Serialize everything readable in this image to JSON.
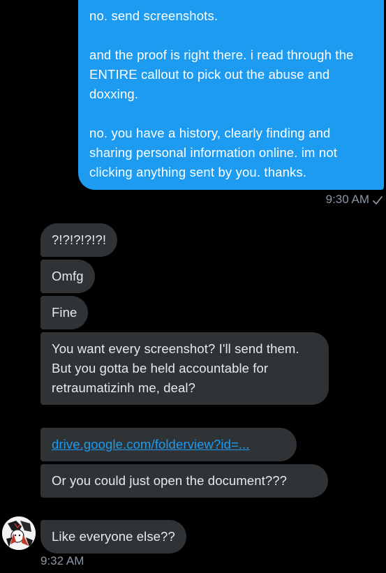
{
  "sent_message": {
    "paragraphs": [
      "no. send screenshots.",
      "and the proof is right there. i read through the ENTIRE callout to pick out the abuse and doxxing.",
      "no. you have a history, clearly finding and sharing personal information online. im not clicking anything sent by you. thanks."
    ],
    "timestamp": "9:30 AM",
    "status_icon": "check-icon"
  },
  "received_messages": [
    {
      "text": "?!?!?!?!?!"
    },
    {
      "text": "Omfg"
    },
    {
      "text": "Fine"
    },
    {
      "text": "You want every screenshot? I'll send them. But you gotta be held accountable for retraumatizinh me, deal?"
    },
    {
      "text": "drive.google.com/folderview?id=..."
    },
    {
      "text": "Or you could just open the document???"
    },
    {
      "text": "Like everyone else??"
    }
  ],
  "received_timestamp": "9:32 AM",
  "avatar_icon": "avatar-icon",
  "colors": {
    "background": "#000000",
    "sent_bubble": "#1D9BF0",
    "received_bubble": "#2F3336",
    "received_text": "#E7E9EA",
    "timestamp": "#8B98A5",
    "link": "#1D9BF0"
  }
}
